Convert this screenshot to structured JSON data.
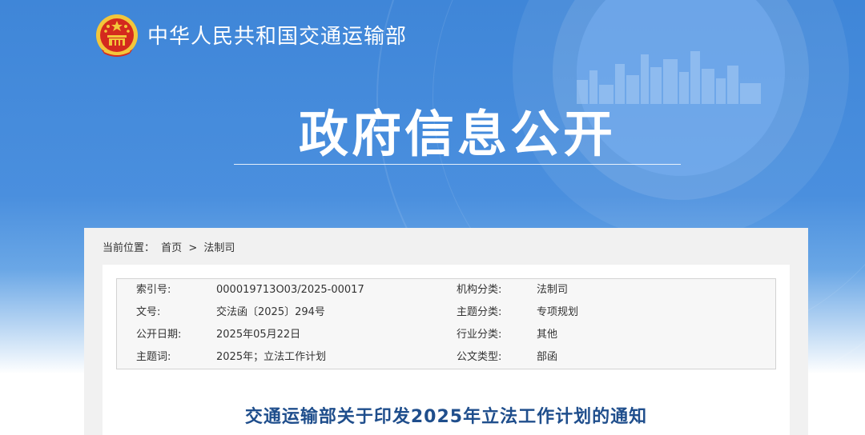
{
  "header": {
    "org_name": "中华人民共和国交通运输部",
    "hero_title": "政府信息公开"
  },
  "breadcrumb": {
    "prefix": "当前位置：",
    "home": "首页",
    "separator": ">",
    "current": "法制司"
  },
  "meta": {
    "rows": [
      {
        "k1": "索引号:",
        "v1": "000019713O03/2025-00017",
        "k2": "机构分类:",
        "v2": "法制司"
      },
      {
        "k1": "文号:",
        "v1": "交法函〔2025〕294号",
        "k2": "主题分类:",
        "v2": "专项规划"
      },
      {
        "k1": "公开日期:",
        "v1": "2025年05月22日",
        "k2": "行业分类:",
        "v2": "其他"
      },
      {
        "k1": "主题词:",
        "v1": "2025年；立法工作计划",
        "k2": "公文类型:",
        "v2": "部函"
      }
    ]
  },
  "document": {
    "title": "交通运输部关于印发2025年立法工作计划的通知"
  },
  "colors": {
    "banner_blue": "#4a8fde",
    "title_blue": "#1f4e8c",
    "emblem_red": "#d42a1e",
    "emblem_gold": "#f3c63a"
  },
  "icons": {
    "emblem": "national-emblem-icon",
    "skyline": "city-skyline-graphic"
  }
}
